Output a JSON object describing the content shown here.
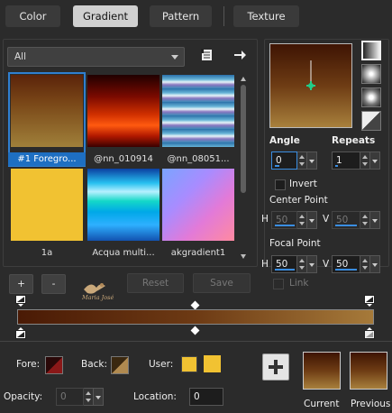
{
  "tabs": [
    {
      "label": "Color",
      "active": false
    },
    {
      "label": "Gradient",
      "active": true
    },
    {
      "label": "Pattern",
      "active": false
    },
    {
      "label": "Texture",
      "active": false
    }
  ],
  "filter": {
    "selected": "All"
  },
  "swatches": [
    {
      "label": "#1 Foregro...",
      "selected": true,
      "icon": "gradient-brown"
    },
    {
      "label": "@nn_010914",
      "selected": false,
      "icon": "gradient-red"
    },
    {
      "label": "@nn_08051...",
      "selected": false,
      "icon": "gradient-teal-stripes"
    },
    {
      "label": "1a",
      "selected": false,
      "icon": "solid-yellow"
    },
    {
      "label": "Acqua multi...",
      "selected": false,
      "icon": "gradient-aqua"
    },
    {
      "label": "akgradient1",
      "selected": false,
      "icon": "gradient-pastel"
    }
  ],
  "buttons": {
    "add": "+",
    "remove": "-",
    "reset": "Reset",
    "save": "Save"
  },
  "watermark": "Maria José",
  "properties": {
    "angle_label": "Angle",
    "angle_value": "0",
    "repeats_label": "Repeats",
    "repeats_value": "1",
    "invert_label": "Invert",
    "center_label": "Center Point",
    "focal_label": "Focal Point",
    "h_label": "H",
    "v_label": "V",
    "center_h": "50",
    "center_v": "50",
    "focal_h": "50",
    "focal_v": "50",
    "link_label": "Link"
  },
  "bottom": {
    "fore_label": "Fore:",
    "back_label": "Back:",
    "user_label": "User:",
    "opacity_label": "Opacity:",
    "opacity_value": "0",
    "location_label": "Location:",
    "location_value": "0",
    "current_label": "Current",
    "previous_label": "Previous"
  },
  "colors": {
    "gradient_dark": "#4a1a05",
    "gradient_light": "#a67a3a",
    "accent_blue": "#3a8de0",
    "user_yellow": "#f1c232"
  }
}
